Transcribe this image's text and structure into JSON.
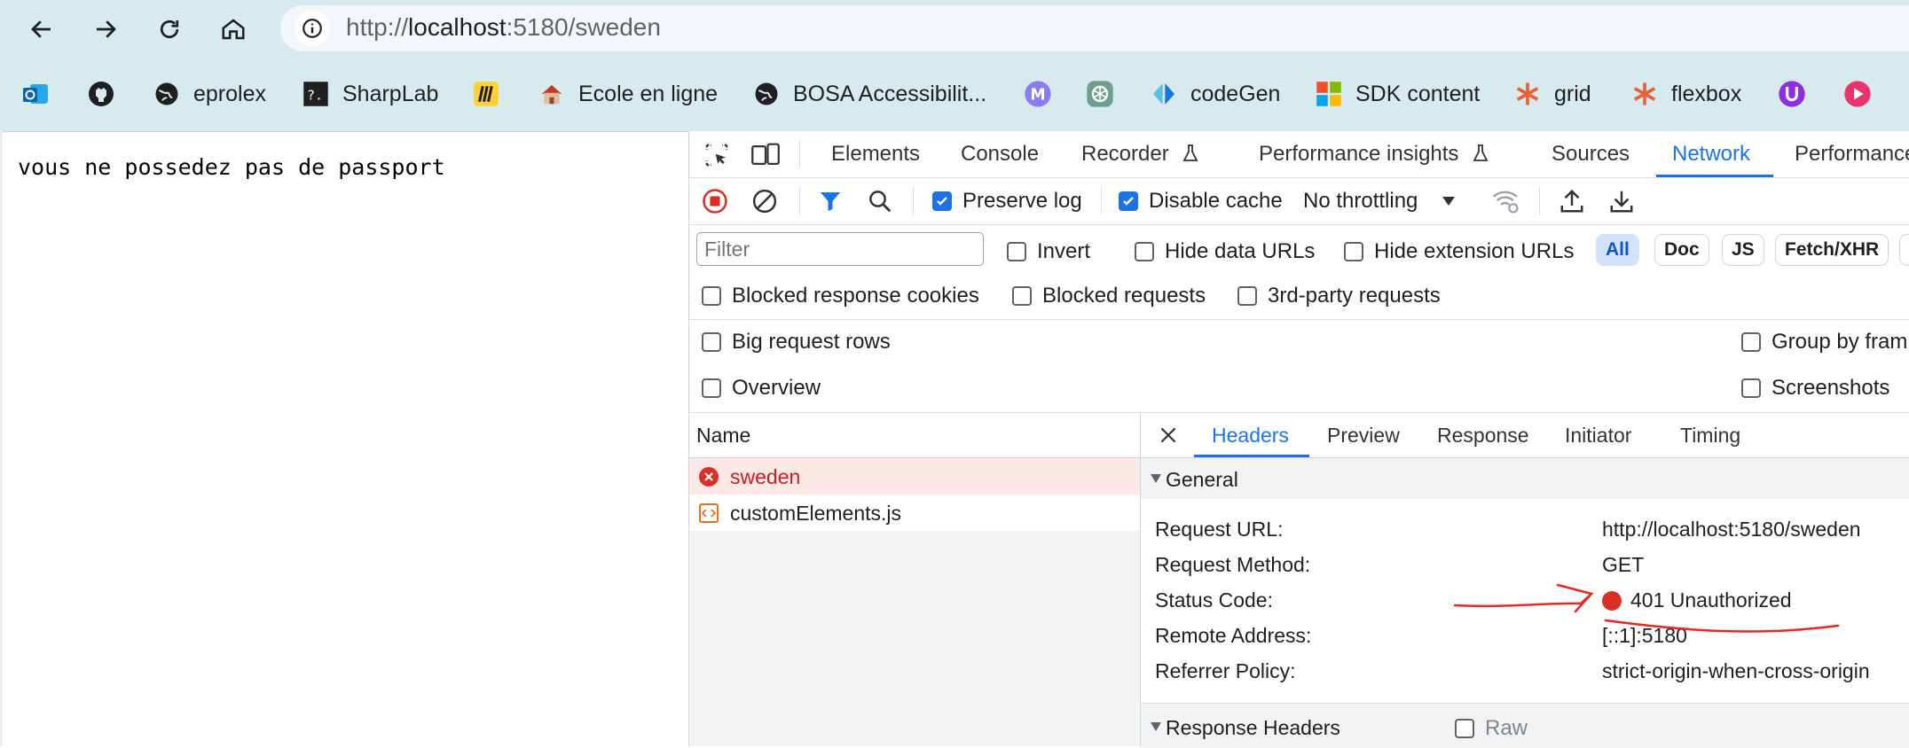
{
  "browser": {
    "url_scheme": "http://",
    "url_host": "localhost",
    "url_rest": ":5180/sweden",
    "bookmarks": [
      {
        "label": "eprolex",
        "icon": "globe-icon"
      },
      {
        "label": "SharpLab",
        "icon": "sharplab-icon"
      },
      {
        "label": "Ecole en ligne",
        "icon": "school-icon"
      },
      {
        "label": "BOSA Accessibilit...",
        "icon": "globe-icon"
      },
      {
        "label": "codeGen",
        "icon": "codegen-icon"
      },
      {
        "label": "SDK content",
        "icon": "microsoft-icon"
      },
      {
        "label": "grid",
        "icon": "asterisk-icon"
      },
      {
        "label": "flexbox",
        "icon": "asterisk-icon"
      }
    ]
  },
  "page": {
    "message": "vous ne possedez pas de passport"
  },
  "devtools": {
    "tabs": [
      "Elements",
      "Console",
      "Recorder",
      "Performance insights",
      "Sources",
      "Network",
      "Performance"
    ],
    "active_tab": "Network",
    "toolbar": {
      "preserve_log": "Preserve log",
      "disable_cache": "Disable cache",
      "throttling": "No throttling"
    },
    "filter": {
      "placeholder": "Filter",
      "invert": "Invert",
      "hide_data_urls": "Hide data URLs",
      "hide_extension_urls": "Hide extension URLs",
      "types": [
        "All",
        "Doc",
        "JS",
        "Fetch/XHR"
      ],
      "blocked_response_cookies": "Blocked response cookies",
      "blocked_requests": "Blocked requests",
      "third_party": "3rd-party requests"
    },
    "settings": {
      "big_rows": "Big request rows",
      "overview": "Overview",
      "group_by_frame": "Group by fram",
      "screenshots": "Screenshots"
    },
    "requests": {
      "column": "Name",
      "rows": [
        {
          "name": "sweden",
          "status": "error"
        },
        {
          "name": "customElements.js",
          "status": "ok"
        }
      ]
    },
    "details": {
      "tabs": [
        "Headers",
        "Preview",
        "Response",
        "Initiator",
        "Timing"
      ],
      "active": "Headers",
      "general_title": "General",
      "general": [
        {
          "key": "Request URL:",
          "value": "http://localhost:5180/sweden"
        },
        {
          "key": "Request Method:",
          "value": "GET"
        },
        {
          "key": "Status Code:",
          "value": "401 Unauthorized"
        },
        {
          "key": "Remote Address:",
          "value": "[::1]:5180"
        },
        {
          "key": "Referrer Policy:",
          "value": "strict-origin-when-cross-origin"
        }
      ],
      "response_headers_title": "Response Headers",
      "raw_label": "Raw"
    }
  },
  "colors": {
    "accent": "#1a73e8",
    "error": "#d93025",
    "toolbar_bg": "#d7ebee",
    "annotation": "#e8271f"
  }
}
